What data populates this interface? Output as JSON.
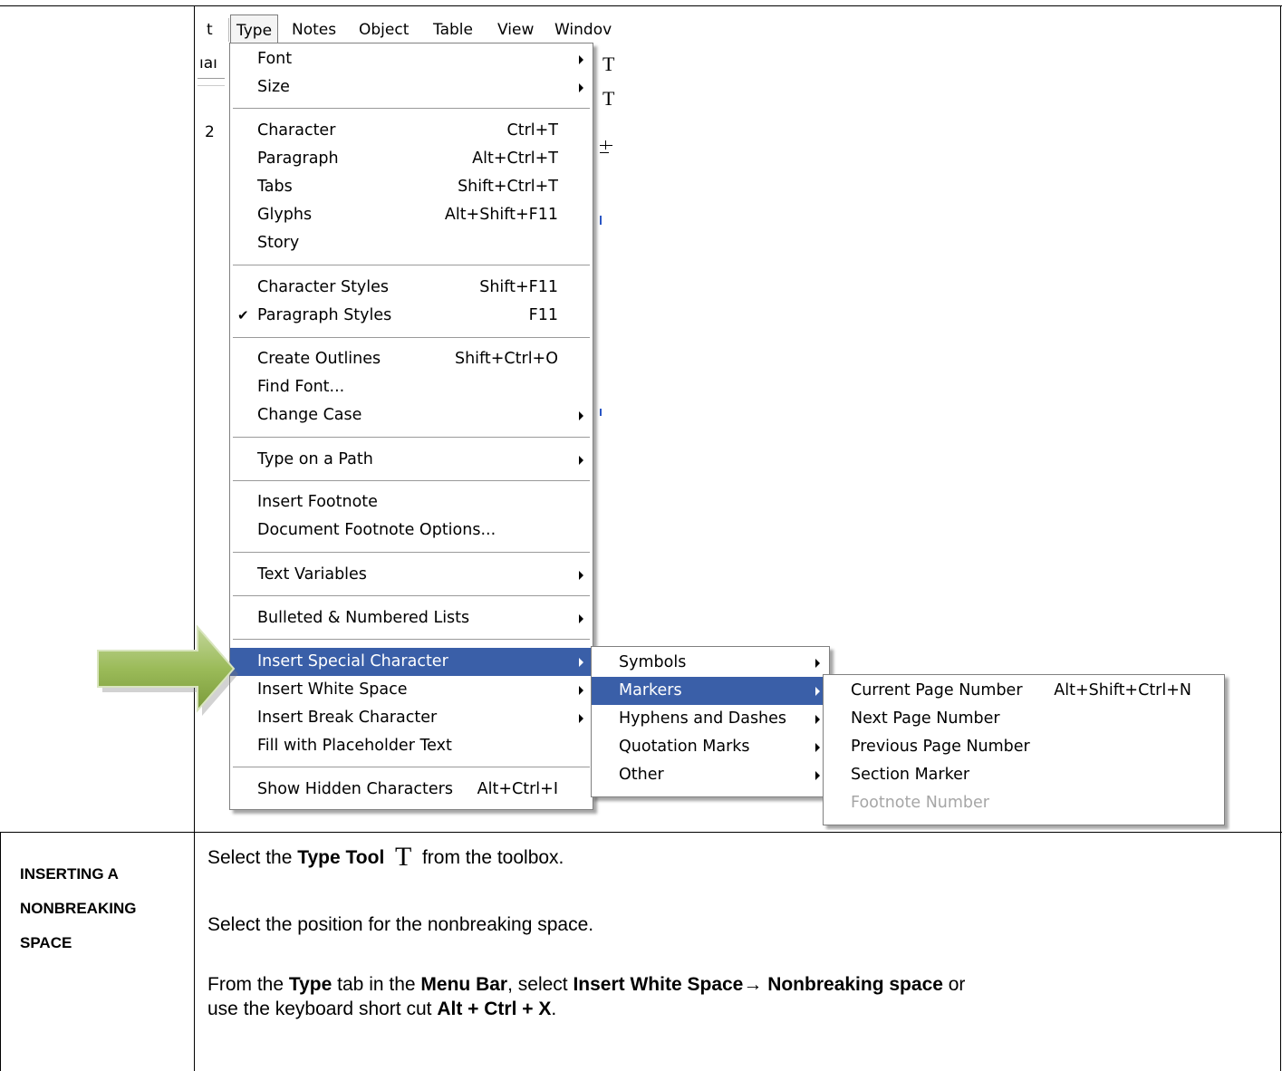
{
  "menubar": {
    "items": [
      {
        "label": "t"
      },
      {
        "label": "Type"
      },
      {
        "label": "Notes"
      },
      {
        "label": "Object"
      },
      {
        "label": "Table"
      },
      {
        "label": "View"
      },
      {
        "label": "Windov"
      }
    ]
  },
  "background_fragments": {
    "left_top": "ıaı",
    "left_ruler": "2",
    "right_T1": "T",
    "right_T2": "T"
  },
  "type_menu": {
    "font": "Font",
    "size": "Size",
    "character": {
      "label": "Character",
      "shortcut": "Ctrl+T"
    },
    "paragraph": {
      "label": "Paragraph",
      "shortcut": "Alt+Ctrl+T"
    },
    "tabs": {
      "label": "Tabs",
      "shortcut": "Shift+Ctrl+T"
    },
    "glyphs": {
      "label": "Glyphs",
      "shortcut": "Alt+Shift+F11"
    },
    "story": "Story",
    "character_styles": {
      "label": "Character Styles",
      "shortcut": "Shift+F11"
    },
    "paragraph_styles": {
      "label": "Paragraph Styles",
      "shortcut": "F11",
      "check": "✔"
    },
    "create_outlines": {
      "label": "Create Outlines",
      "shortcut": "Shift+Ctrl+O"
    },
    "find_font": "Find Font...",
    "change_case": "Change Case",
    "type_on_path": "Type on a Path",
    "insert_footnote": "Insert Footnote",
    "doc_footnote_options": "Document Footnote Options...",
    "text_variables": "Text Variables",
    "bulleted_lists": "Bulleted & Numbered Lists",
    "insert_special_char": "Insert Special Character",
    "insert_white_space": "Insert White Space",
    "insert_break_char": "Insert Break Character",
    "fill_placeholder": "Fill with Placeholder Text",
    "show_hidden": {
      "label": "Show Hidden Characters",
      "shortcut": "Alt+Ctrl+I"
    }
  },
  "special_char_menu": {
    "symbols": "Symbols",
    "markers": "Markers",
    "hyphens": "Hyphens and Dashes",
    "quotation": "Quotation Marks",
    "other": "Other"
  },
  "markers_menu": {
    "current_page": {
      "label": "Current Page Number",
      "shortcut": "Alt+Shift+Ctrl+N"
    },
    "next_page": "Next Page Number",
    "previous_page": "Previous Page Number",
    "section_marker": "Section Marker",
    "footnote_number": "Footnote Number"
  },
  "section": {
    "label_line1": "INSERTING A",
    "label_line2": "NONBREAKING",
    "label_line3": "SPACE",
    "step1_pre": "Select the ",
    "step1_bold": "Type Tool",
    "step1_glyph": "T",
    "step1_post": " from the toolbox.",
    "step2": "Select the position for the nonbreaking space.",
    "step3_a": "From the ",
    "step3_b": "Type",
    "step3_c": " tab in the ",
    "step3_d": "Menu Bar",
    "step3_e": ", select ",
    "step3_f": "Insert White Space",
    "step3_arrow": "→",
    "step3_g": " Nonbreaking space",
    "step3_h": " or",
    "step3_i": "use the keyboard short cut ",
    "step3_j": "Alt + Ctrl + X",
    "step3_k": "."
  },
  "colors": {
    "highlight": "#3a5fa8",
    "arrow_green": "#9bbb59"
  }
}
